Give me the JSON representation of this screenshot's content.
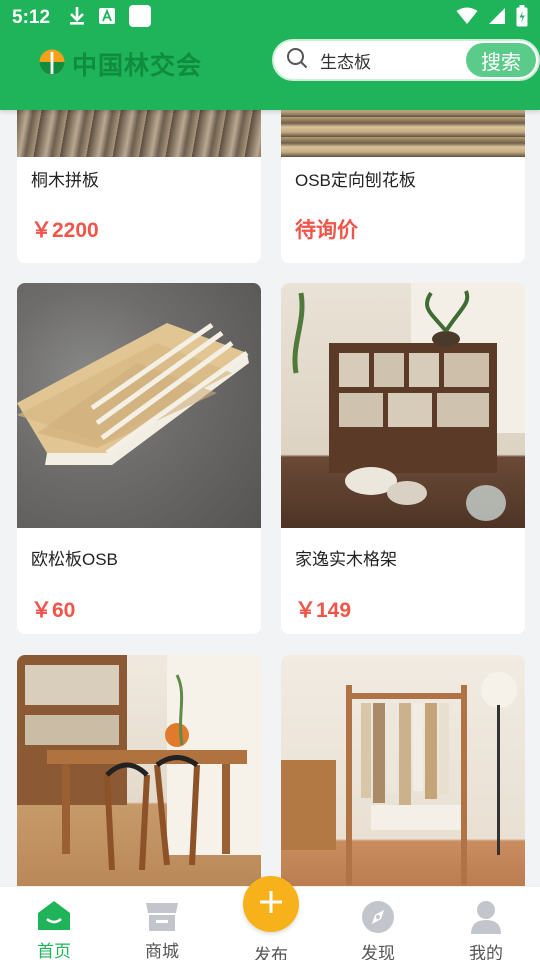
{
  "status_bar": {
    "time": "5:12"
  },
  "header": {
    "logo_text": "中国林交会",
    "search_value": "生态板",
    "search_button": "搜索"
  },
  "products": [
    {
      "title": "桐木拼板",
      "price": "￥2200"
    },
    {
      "title": "OSB定向刨花板",
      "price": "待询价"
    },
    {
      "title": "欧松板OSB",
      "price": "￥60"
    },
    {
      "title": "家逸实木格架",
      "price": "￥149"
    },
    {
      "title": "",
      "price": ""
    },
    {
      "title": "",
      "price": ""
    }
  ],
  "tabbar": {
    "items": [
      {
        "label": "首页",
        "icon": "home-icon"
      },
      {
        "label": "商城",
        "icon": "store-icon"
      },
      {
        "label": "发布",
        "icon": "plus-icon"
      },
      {
        "label": "发现",
        "icon": "compass-icon"
      },
      {
        "label": "我的",
        "icon": "user-icon"
      }
    ]
  },
  "colors": {
    "brand": "#1fb35a",
    "price": "#f0554a",
    "fab": "#f7b21b"
  }
}
